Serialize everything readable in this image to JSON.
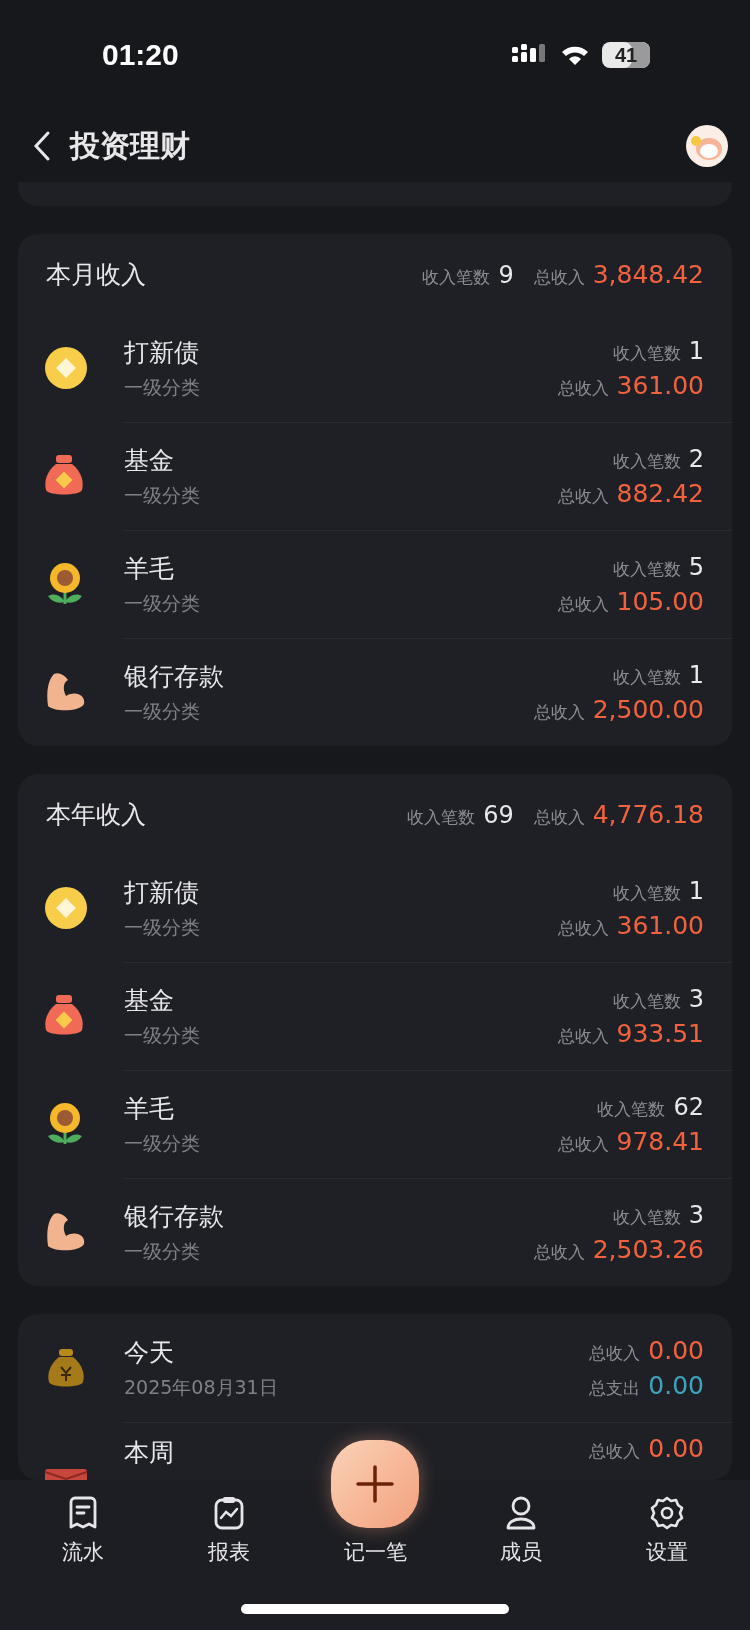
{
  "status_bar": {
    "time": "01:20",
    "battery": "41"
  },
  "header": {
    "title": "投资理财"
  },
  "sections": [
    {
      "title": "本月收入",
      "count_label": "收入笔数",
      "count": "9",
      "total_label": "总收入",
      "total": "3,848.42",
      "items": [
        {
          "kind": "coin",
          "name": "打新债",
          "sub": "一级分类",
          "count_label": "收入笔数",
          "count": "1",
          "total_label": "总收入",
          "total": "361.00"
        },
        {
          "kind": "bag",
          "name": "基金",
          "sub": "一级分类",
          "count_label": "收入笔数",
          "count": "2",
          "total_label": "总收入",
          "total": "882.42"
        },
        {
          "kind": "flower",
          "name": "羊毛",
          "sub": "一级分类",
          "count_label": "收入笔数",
          "count": "5",
          "total_label": "总收入",
          "total": "105.00"
        },
        {
          "kind": "arm",
          "name": "银行存款",
          "sub": "一级分类",
          "count_label": "收入笔数",
          "count": "1",
          "total_label": "总收入",
          "total": "2,500.00"
        }
      ]
    },
    {
      "title": "本年收入",
      "count_label": "收入笔数",
      "count": "69",
      "total_label": "总收入",
      "total": "4,776.18",
      "items": [
        {
          "kind": "coin",
          "name": "打新债",
          "sub": "一级分类",
          "count_label": "收入笔数",
          "count": "1",
          "total_label": "总收入",
          "total": "361.00"
        },
        {
          "kind": "bag",
          "name": "基金",
          "sub": "一级分类",
          "count_label": "收入笔数",
          "count": "3",
          "total_label": "总收入",
          "total": "933.51"
        },
        {
          "kind": "flower",
          "name": "羊毛",
          "sub": "一级分类",
          "count_label": "收入笔数",
          "count": "62",
          "total_label": "总收入",
          "total": "978.41"
        },
        {
          "kind": "arm",
          "name": "银行存款",
          "sub": "一级分类",
          "count_label": "收入笔数",
          "count": "3",
          "total_label": "总收入",
          "total": "2,503.26"
        }
      ]
    }
  ],
  "periods": [
    {
      "kind": "moneybag",
      "name": "今天",
      "date": "2025年08月31日",
      "income_label": "总收入",
      "income": "0.00",
      "expense_label": "总支出",
      "expense": "0.00"
    },
    {
      "kind": "envelope",
      "name": "本周",
      "income_label": "总收入",
      "income": "0.00"
    }
  ],
  "tab_bar": [
    {
      "kind": "receipt",
      "label": "流水"
    },
    {
      "kind": "chart",
      "label": "报表"
    },
    {
      "kind": "add",
      "label": "记一笔"
    },
    {
      "kind": "person",
      "label": "成员"
    },
    {
      "kind": "gear",
      "label": "设置"
    }
  ]
}
